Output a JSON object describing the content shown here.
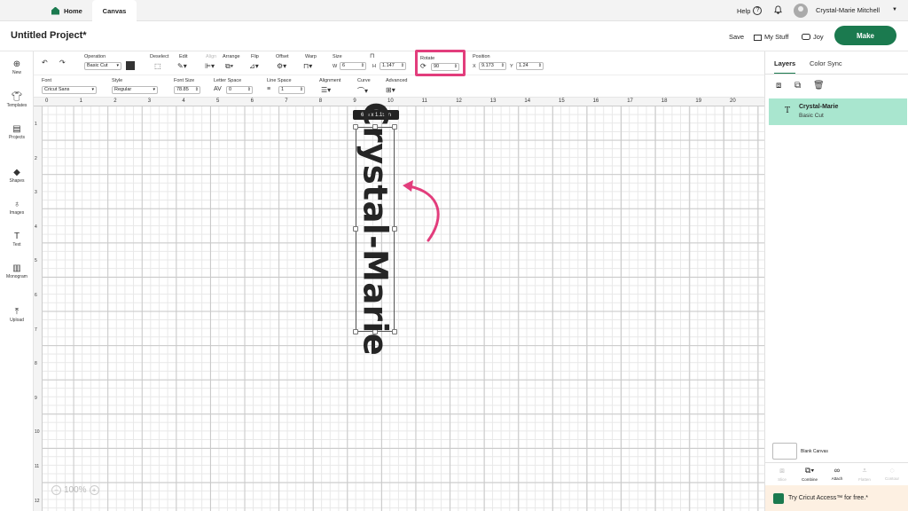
{
  "nav": {
    "home": "Home",
    "canvas": "Canvas",
    "help": "Help",
    "help_glyph": "?",
    "user": "Crystal-Marie Mitchell"
  },
  "project": {
    "title": "Untitled Project*",
    "save": "Save",
    "my_stuff": "My Stuff",
    "joy": "Joy",
    "make": "Make"
  },
  "toolbar": {
    "operation_label": "Operation",
    "operation_value": "Basic Cut",
    "deselect": "Deselect",
    "edit": "Edit",
    "align": "Align",
    "arrange": "Arrange",
    "flip": "Flip",
    "offset": "Offset",
    "warp": "Warp",
    "size_label": "Size",
    "w_label": "W",
    "w_value": "6",
    "h_label": "H",
    "h_value": "1.147",
    "rotate_label": "Rotate",
    "rotate_value": "90",
    "position_label": "Position",
    "x_label": "X",
    "x_value": "9.173",
    "y_label": "Y",
    "y_value": "1.24"
  },
  "textbar": {
    "font_label": "Font",
    "font_value": "Cricut Sans",
    "style_label": "Style",
    "style_value": "Regular",
    "font_size_label": "Font Size",
    "font_size_value": "78.85",
    "letter_space_label": "Letter Space",
    "letter_space_value": "0",
    "line_space_label": "Line Space",
    "line_space_value": "1",
    "alignment_label": "Alignment",
    "curve_label": "Curve",
    "advanced_label": "Advanced"
  },
  "sidebar": [
    {
      "label": "New",
      "icon": "plus-icon"
    },
    {
      "label": "Templates",
      "icon": "shirt-icon"
    },
    {
      "label": "Projects",
      "icon": "clipboard-icon"
    },
    {
      "label": "Shapes",
      "icon": "shapes-icon"
    },
    {
      "label": "Images",
      "icon": "bulb-icon"
    },
    {
      "label": "Text",
      "icon": "text-icon"
    },
    {
      "label": "Monogram",
      "icon": "monogram-icon"
    },
    {
      "label": "Upload",
      "icon": "upload-icon"
    }
  ],
  "ruler": {
    "top": [
      "0",
      "1",
      "2",
      "3",
      "4",
      "5",
      "6",
      "7",
      "8",
      "9",
      "10",
      "11",
      "12",
      "13",
      "14",
      "15",
      "16",
      "17",
      "18",
      "19",
      "20",
      "2"
    ],
    "left": [
      "1",
      "2",
      "3",
      "4",
      "5",
      "6",
      "7",
      "8",
      "9",
      "10",
      "11",
      "12"
    ]
  },
  "canvas": {
    "dimension_tag": "6  in x 1.15  in",
    "text": "Crystal-Marie",
    "zoom": "100%",
    "zoom_minus": "−",
    "zoom_plus": "+"
  },
  "panel": {
    "tab_layers": "Layers",
    "tab_color_sync": "Color Sync",
    "layer_name": "Crystal-Marie",
    "layer_op": "Basic Cut",
    "layer_type_glyph": "T",
    "blank_canvas": "Blank Canvas",
    "actions": [
      "Slice",
      "Combine",
      "Attach",
      "Flatten",
      "Contour"
    ],
    "promo": "Try Cricut Access™ for free.*"
  },
  "colors": {
    "accent": "#1b7a4f",
    "highlight": "#e23d7c",
    "layer_selected": "#a9e6cf"
  }
}
